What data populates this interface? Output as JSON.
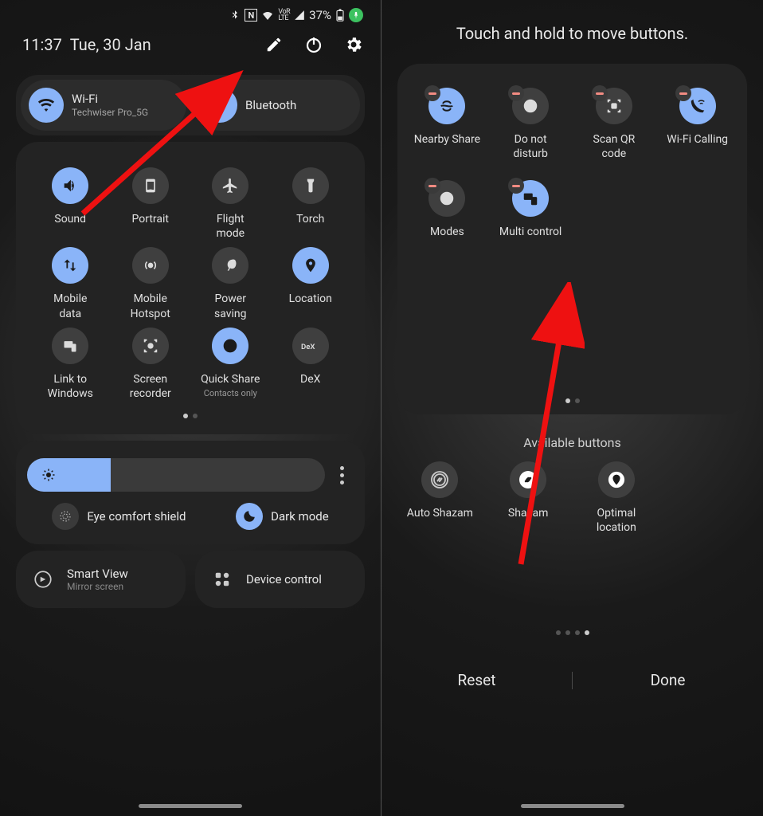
{
  "left": {
    "status": {
      "battery": "37%",
      "nfc": "N"
    },
    "time": "11:37",
    "date": "Tue, 30 Jan",
    "wifi": {
      "label": "Wi-Fi",
      "sub": "Techwiser Pro_5G"
    },
    "bluetooth": {
      "label": "Bluetooth"
    },
    "tiles": [
      {
        "label": "Sound",
        "active": true
      },
      {
        "label": "Portrait",
        "active": false
      },
      {
        "label": "Flight\nmode",
        "active": false
      },
      {
        "label": "Torch",
        "active": false
      },
      {
        "label": "Mobile\ndata",
        "active": true
      },
      {
        "label": "Mobile\nHotspot",
        "active": false
      },
      {
        "label": "Power\nsaving",
        "active": false
      },
      {
        "label": "Location",
        "active": true
      },
      {
        "label": "Link to\nWindows",
        "active": false
      },
      {
        "label": "Screen\nrecorder",
        "active": false
      },
      {
        "label": "Quick Share",
        "sub": "Contacts only",
        "active": true
      },
      {
        "label": "DeX",
        "active": false
      }
    ],
    "eye_comfort": "Eye comfort shield",
    "dark_mode": "Dark mode",
    "smart_view": {
      "label": "Smart View",
      "sub": "Mirror screen"
    },
    "device_control": "Device control"
  },
  "right": {
    "title": "Touch and hold to move buttons.",
    "tiles": [
      {
        "label": "Nearby Share",
        "active": true
      },
      {
        "label": "Do not\ndisturb",
        "active": false
      },
      {
        "label": "Scan QR\ncode",
        "active": false
      },
      {
        "label": "Wi-Fi Calling",
        "active": true
      },
      {
        "label": "Modes",
        "active": false
      },
      {
        "label": "Multi control",
        "active": true
      }
    ],
    "available_label": "Available buttons",
    "available": [
      {
        "label": "Auto Shazam"
      },
      {
        "label": "Shazam"
      },
      {
        "label": "Optimal\nlocation"
      }
    ],
    "reset": "Reset",
    "done": "Done"
  }
}
